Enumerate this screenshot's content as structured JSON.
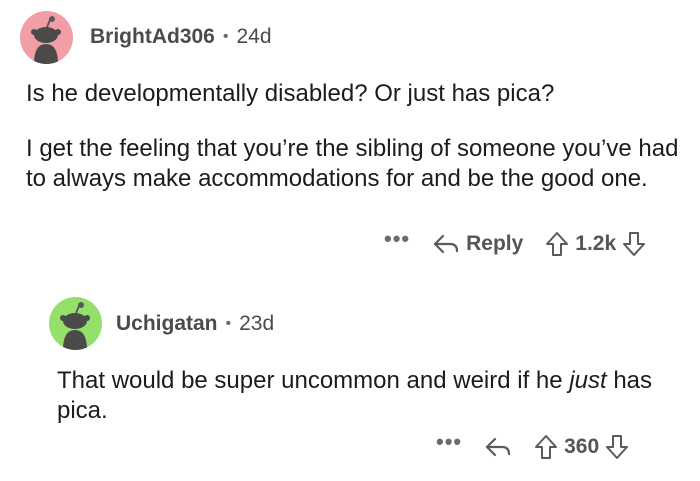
{
  "comments": [
    {
      "username": "BrightAd306",
      "separator": "•",
      "age": "24d",
      "avatar_color": "#f19ea6",
      "paragraphs": [
        "Is he developmentally disabled? Or just has pica?",
        "I get the feeling that you’re the sibling of someone you’ve had to always make accommodations for and be the good one."
      ],
      "actions": {
        "more": "•••",
        "reply_label": "Reply",
        "score": "1.2k"
      }
    },
    {
      "username": "Uchigatan",
      "separator": "•",
      "age": "23d",
      "avatar_color": "#95e06b",
      "text_before": "That would be super uncommon and weird if he ",
      "text_emphasis": "just",
      "text_after": " has pica.",
      "actions": {
        "more": "•••",
        "score": "360"
      }
    }
  ],
  "icons": {
    "avatar": "snoo-avatar-icon",
    "reply": "reply-arrow-icon",
    "upvote": "upvote-arrow-icon",
    "downvote": "downvote-arrow-icon"
  }
}
